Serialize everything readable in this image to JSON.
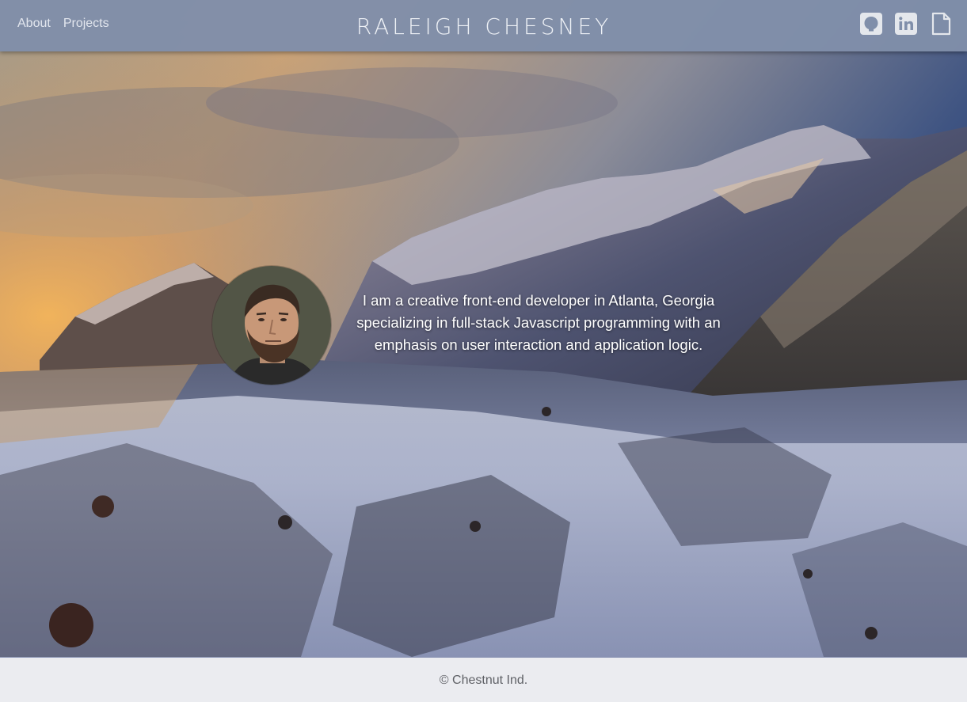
{
  "header": {
    "nav": [
      {
        "label": "About"
      },
      {
        "label": "Projects"
      }
    ],
    "brand": "RALEIGH CHESNEY",
    "social": [
      {
        "icon": "github-icon"
      },
      {
        "icon": "linkedin-icon"
      },
      {
        "icon": "document-icon"
      }
    ]
  },
  "hero": {
    "intro": "I am a creative front-end developer in Atlanta, Georgia specializing in full-stack Javascript programming with an emphasis on user interaction and application logic."
  },
  "footer": {
    "copyright": "© Chestnut Ind."
  },
  "colors": {
    "header_bg": "#808faa",
    "footer_bg": "#f0f1f3",
    "icon": "#e4e7ec"
  }
}
